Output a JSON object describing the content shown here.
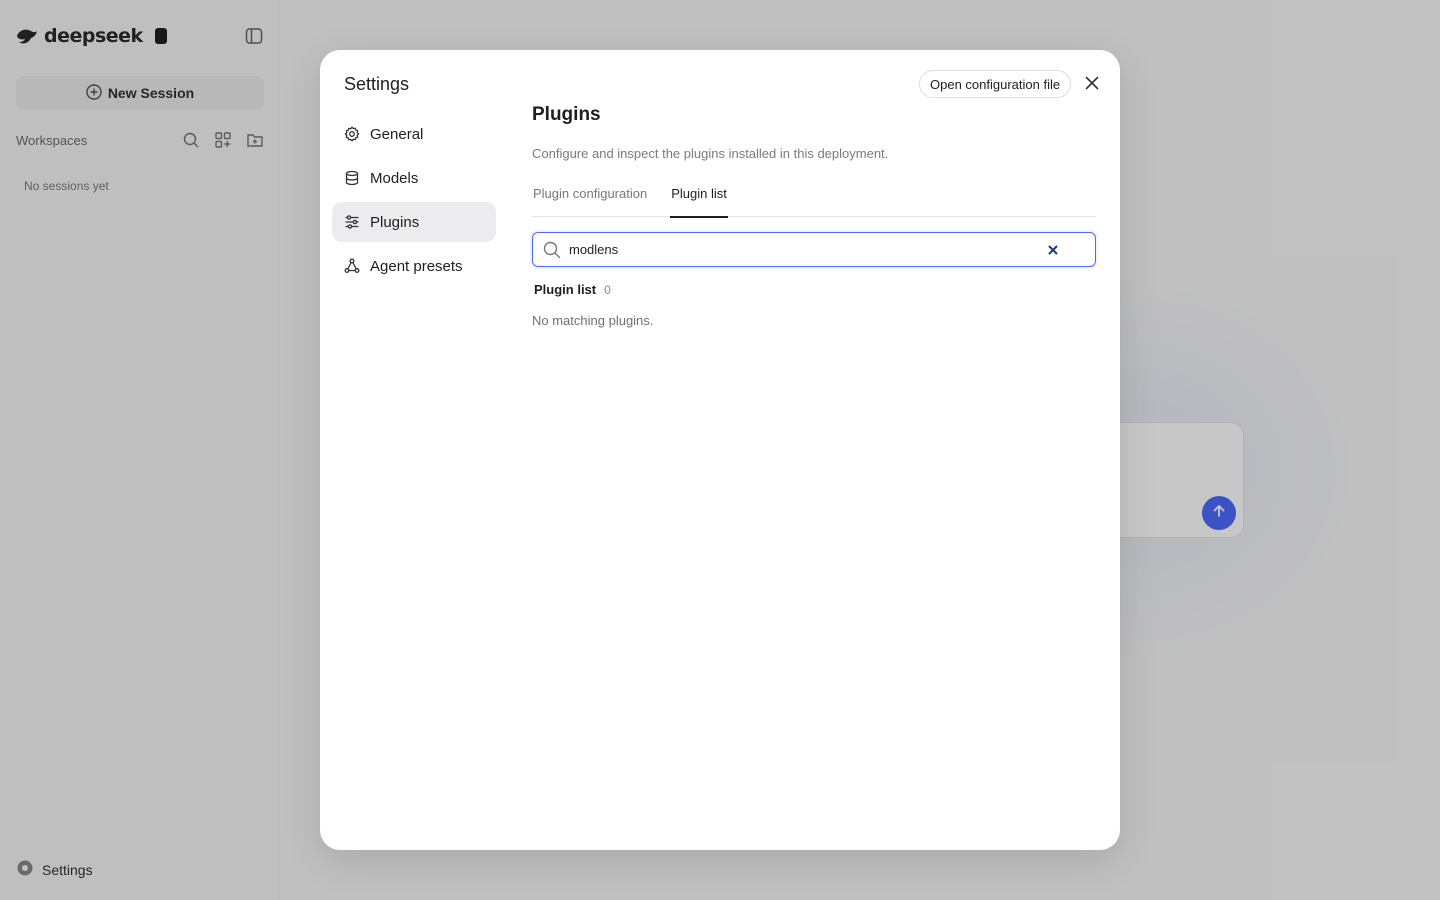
{
  "app": {
    "logo_text": "deepseek",
    "logo_badge": "",
    "new_session_label": "New Session",
    "workspaces_label": "Workspaces",
    "no_sessions_text": "No sessions yet",
    "settings_label": "Settings",
    "accent_color": "#4d6bfe"
  },
  "modal": {
    "title": "Settings",
    "open_config_label": "Open configuration file",
    "nav": [
      {
        "label": "General",
        "icon": "gear-icon",
        "active": false
      },
      {
        "label": "Models",
        "icon": "database-icon",
        "active": false
      },
      {
        "label": "Plugins",
        "icon": "sliders-icon",
        "active": true
      },
      {
        "label": "Agent presets",
        "icon": "share-nodes-icon",
        "active": false
      }
    ],
    "content": {
      "title": "Plugins",
      "description": "Configure and inspect the plugins installed in this deployment.",
      "tabs": [
        {
          "label": "Plugin configuration",
          "active": false
        },
        {
          "label": "Plugin list",
          "active": true
        }
      ],
      "search": {
        "value": "modlens",
        "placeholder": ""
      },
      "list_label": "Plugin list",
      "list_count": "0",
      "empty_text": "No matching plugins."
    }
  }
}
